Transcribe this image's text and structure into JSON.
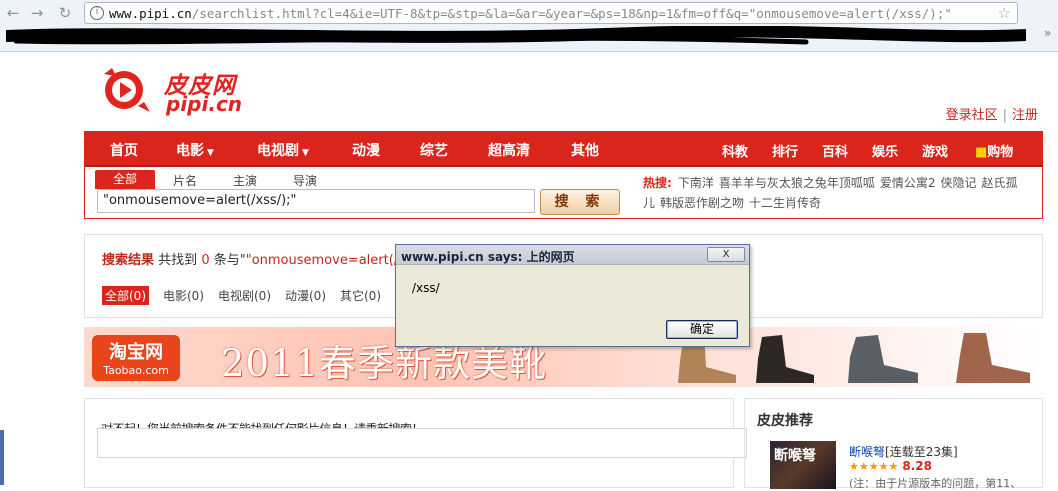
{
  "browser": {
    "url_host": "www.pipi.cn",
    "url_path": "/searchlist.html?cl=4&ie=UTF-8&tp=&stp=&la=&ar=&year=&ps=18&np=1&fm=off&q=\"onmousemove=alert(/xss/);\""
  },
  "site": {
    "logo_cn": "皮皮网",
    "logo_en": "pipi.cn",
    "login": "登录社区",
    "register": "注册"
  },
  "nav": {
    "main": [
      "首页",
      "电影",
      "电视剧",
      "动漫",
      "综艺",
      "超高清",
      "其他"
    ],
    "caret": "▼",
    "right": [
      "科教",
      "排行",
      "百科",
      "娱乐",
      "游戏",
      "购物"
    ]
  },
  "search": {
    "tabs": [
      "全部",
      "片名",
      "主演",
      "导演"
    ],
    "value": "\"onmousemove=alert(/xss/);\"",
    "button": "搜 索",
    "hot_label": "热搜:",
    "hot_keywords": [
      "下南洋",
      "喜羊羊与灰太狼之兔年顶呱呱",
      "爱情公寓2",
      "侠隐记",
      "赵氏孤儿",
      "韩版恶作剧之吻",
      "十二生肖传奇"
    ]
  },
  "results": {
    "title": "搜索结果",
    "prefix": "共找到",
    "count": "0",
    "mid": "条与\"",
    "query": "\"onmousemove=alert(/xs",
    "filters": [
      "全部(0)",
      "电影(0)",
      "电视剧(0)",
      "动漫(0)",
      "其它(0)"
    ]
  },
  "banner": {
    "logo_line1": "淘宝网",
    "logo_line2": "Taobao.com",
    "text": "2011春季新款美靴"
  },
  "notfound": {
    "text": "对不起！您当前搜索条件不能找到任何影片信息！请重新搜索！"
  },
  "recommend": {
    "title": "皮皮推荐",
    "poster_text": "断喉弩",
    "item_name": "断喉弩",
    "item_episodes": "[连载至23集]",
    "stars": "★★★★★",
    "score": "8.28",
    "note": "(注：由于片源版本的问题，第11、"
  },
  "dialog": {
    "title": "www.pipi.cn says: 上的网页",
    "close": "X",
    "message": "/xss/",
    "ok": "确定"
  }
}
